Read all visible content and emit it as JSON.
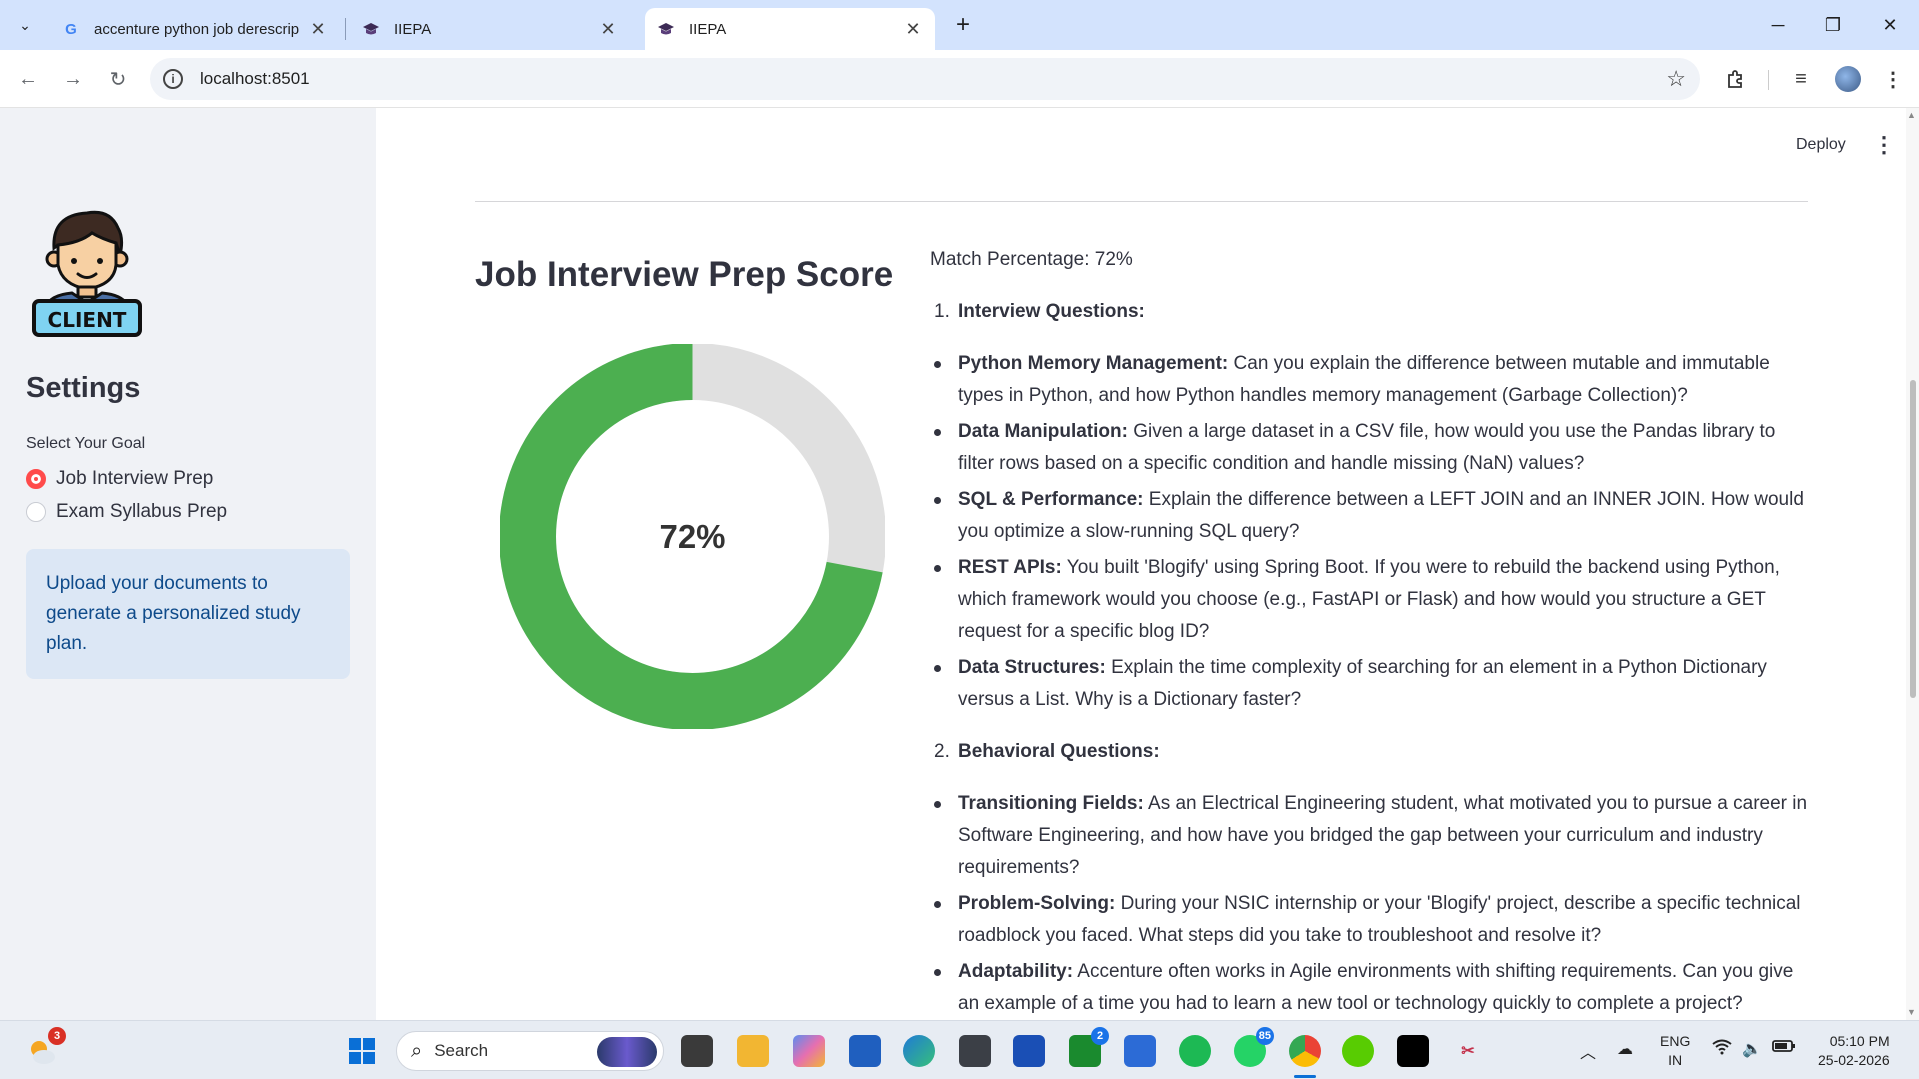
{
  "browser": {
    "tabs": [
      {
        "title": "accenture python job derescrip",
        "favicon": "G"
      },
      {
        "title": "IIEPA",
        "favicon": "graduation-cap"
      },
      {
        "title": "IIEPA",
        "favicon": "graduation-cap"
      }
    ],
    "url": "localhost:8501"
  },
  "sidebar": {
    "logo_text": "CLIENT",
    "settings_title": "Settings",
    "goal_label": "Select Your Goal",
    "options": [
      "Job Interview Prep",
      "Exam Syllabus Prep"
    ],
    "selected_option": "Job Interview Prep",
    "info": "Upload your documents to generate a personalized study plan."
  },
  "header": {
    "deploy_label": "Deploy",
    "menu_glyph": "⋮"
  },
  "main": {
    "score_title": "Job Interview Prep Score",
    "score_label": "72%",
    "score_value": 72,
    "score_color": "#4caf50",
    "score_remainder_color": "#e0e0e0",
    "match_text": "Match Percentage: 72%",
    "sections": [
      {
        "num": "1.",
        "title": "Interview Questions:",
        "items": [
          {
            "label": "Python Memory Management:",
            "text": "Can you explain the difference between mutable and immutable types in Python, and how Python handles memory management (Garbage Collection)?"
          },
          {
            "label": "Data Manipulation:",
            "text": "Given a large dataset in a CSV file, how would you use the Pandas library to filter rows based on a specific condition and handle missing (NaN) values?"
          },
          {
            "label": "SQL & Performance:",
            "text": "Explain the difference between a LEFT JOIN and an INNER JOIN. How would you optimize a slow-running SQL query?"
          },
          {
            "label": "REST APIs:",
            "text": "You built 'Blogify' using Spring Boot. If you were to rebuild the backend using Python, which framework would you choose (e.g., FastAPI or Flask) and how would you structure a GET request for a specific blog ID?"
          },
          {
            "label": "Data Structures:",
            "text": "Explain the time complexity of searching for an element in a Python Dictionary versus a List. Why is a Dictionary faster?"
          }
        ]
      },
      {
        "num": "2.",
        "title": "Behavioral Questions:",
        "items": [
          {
            "label": "Transitioning Fields:",
            "text": "As an Electrical Engineering student, what motivated you to pursue a career in Software Engineering, and how have you bridged the gap between your curriculum and industry requirements?"
          },
          {
            "label": "Problem-Solving:",
            "text": "During your NSIC internship or your 'Blogify' project, describe a specific technical roadblock you faced. What steps did you take to troubleshoot and resolve it?"
          },
          {
            "label": "Adaptability:",
            "text": "Accenture often works in Agile environments with shifting requirements. Can you give an example of a time you had to learn a new tool or technology quickly to complete a project?"
          }
        ]
      }
    ]
  },
  "taskbar": {
    "search_label": "Search",
    "weather_badge": "3",
    "xbox_badge": "2",
    "whatsapp_badge": "85",
    "lang_line1": "ENG",
    "lang_line2": "IN",
    "time": "05:10 PM",
    "date": "25-02-2026"
  }
}
